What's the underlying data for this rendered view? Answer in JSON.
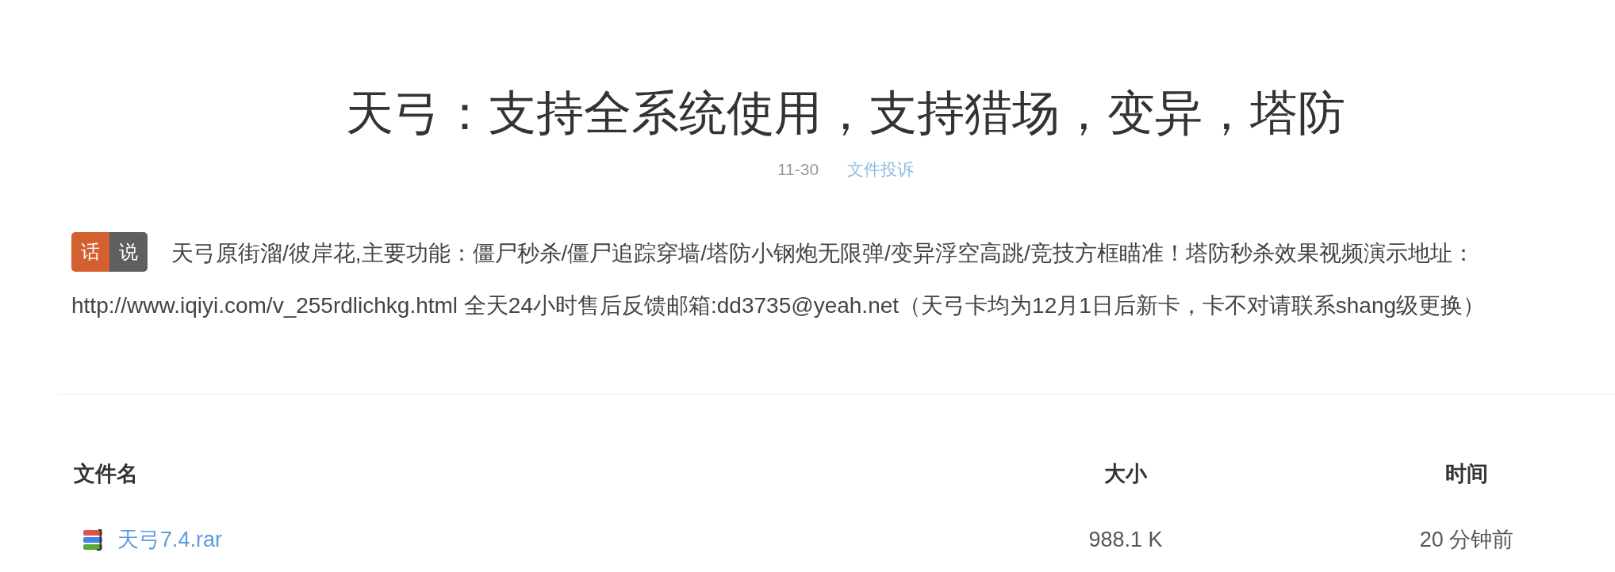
{
  "title": "天弓：支持全系统使用，支持猎场，变异，塔防",
  "meta": {
    "date": "11-30",
    "report_link": "文件投诉"
  },
  "notice": {
    "badge": [
      {
        "label": "话",
        "color": "#d5602f"
      },
      {
        "label": "说",
        "color": "#5f5f5f"
      }
    ],
    "text": "天弓原街溜/彼岸花,主要功能：僵尸秒杀/僵尸追踪穿墙/塔防小钢炮无限弹/变异浮空高跳/竞技方框瞄准！塔防秒杀效果视频演示地址：http://www.iqiyi.com/v_255rdlichkg.html 全天24小时售后反馈邮箱:dd3735@yeah.net（天弓卡均为12月1日后新卡，卡不对请联系shang级更换）"
  },
  "files": {
    "columns": [
      "文件名",
      "大小",
      "时间"
    ],
    "rows": [
      {
        "name": "天弓7.4.rar",
        "size": "988.1 K",
        "time": "20 分钟前"
      }
    ]
  }
}
